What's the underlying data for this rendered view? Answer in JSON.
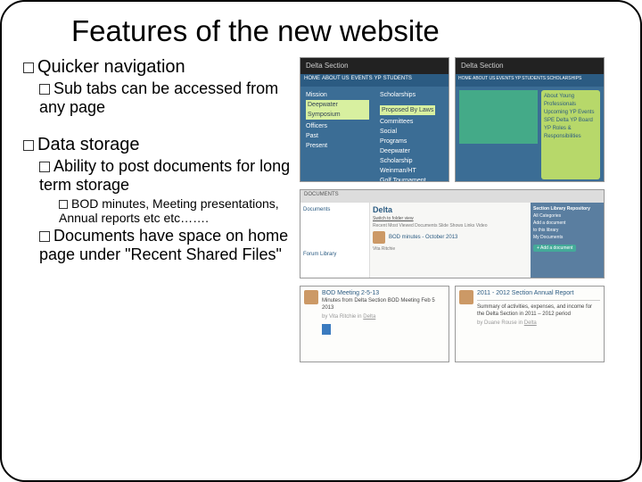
{
  "title": "Features of the new website",
  "bullets": {
    "quicker": "Quicker navigation",
    "sub_tabs": "Sub tabs can be accessed from any page",
    "data_storage": "Data storage",
    "ability": "Ability to post documents for long term storage",
    "bod": "BOD minutes, Meeting presentations, Annual reports etc etc…….",
    "docs_home": "Documents have space on home page under \"Recent Shared Files\""
  },
  "nav1": {
    "header": "Delta Section",
    "menu": [
      "HOME",
      "ABOUT US",
      "EVENTS",
      "YP",
      "STUDENTS"
    ],
    "col1": [
      "Mission",
      "Officers",
      "Past",
      "Present"
    ],
    "col2_hl1": "Deepwater Symposium",
    "col2_hl2": "Proposed By Laws",
    "col2": [
      "Scholarships",
      "Committees",
      "Social",
      "Programs",
      "Deepwater",
      "Scholarship",
      "Weinman/HT",
      "Golf Tournament"
    ]
  },
  "nav2": {
    "header": "Delta Section",
    "menu": [
      "HOME",
      "ABOUT US",
      "EVENTS",
      "YP",
      "STUDENTS",
      "SCHOLARSHIPS"
    ],
    "side": [
      "About Young Professionals",
      "Upcoming YP Events",
      "SPE Delta YP Board",
      "YP Roles & Responsibilities"
    ]
  },
  "doc1": {
    "top": "DOCUMENTS",
    "left": [
      "Documents",
      "Forum Library"
    ],
    "brand": "Delta",
    "tabs": "Recent  Most Viewed  Documents  Slide Shows  Links  Video",
    "doc_title": "BOD minutes - October 2013",
    "author": "Vita Ritchie",
    "btn": "+ Add a document",
    "right_title": "Section Library Repository",
    "right": [
      "All Categories",
      "Add a document",
      "to this library",
      "My Documents"
    ]
  },
  "doc2": {
    "title": "BOD Meeting 2-5-13",
    "sub": "Minutes from Delta Section BOD Meeting Feb 5 2013",
    "author": "Vita Ritchie"
  },
  "doc3": {
    "title": "2011 - 2012 Section Annual Report",
    "sub": "Summary of activities, expenses, and income for the Delta Section in 2011 – 2012 period",
    "author": "Duane Rouse"
  }
}
